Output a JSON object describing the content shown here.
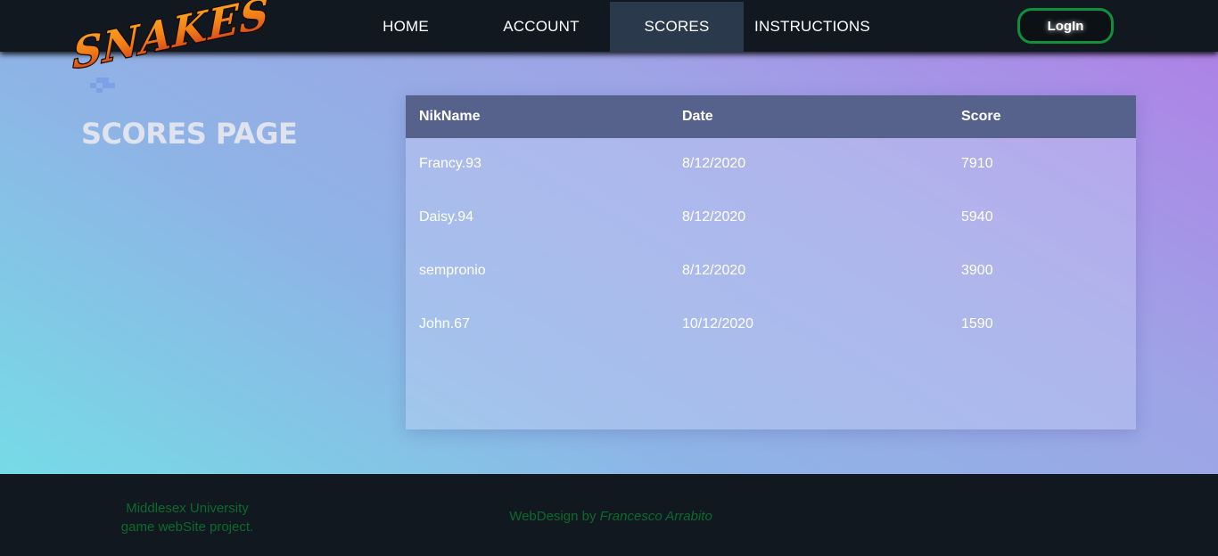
{
  "logo": {
    "text": "SNAKES"
  },
  "nav": {
    "items": [
      {
        "label": "HOME"
      },
      {
        "label": "ACCOUNT"
      },
      {
        "label": "SCORES"
      },
      {
        "label": "INSTRUCTIONS"
      }
    ],
    "active": "SCORES",
    "login_label": "LogIn"
  },
  "page": {
    "title": "SCORES PAGE"
  },
  "scores": {
    "headers": [
      "NikName",
      "Date",
      "Score"
    ],
    "rows": [
      {
        "name": "Francy.93",
        "date": "8/12/2020",
        "score": "7910"
      },
      {
        "name": "Daisy.94",
        "date": "8/12/2020",
        "score": "5940"
      },
      {
        "name": "sempronio",
        "date": "8/12/2020",
        "score": "3900"
      },
      {
        "name": "John.67",
        "date": "10/12/2020",
        "score": "1590"
      }
    ]
  },
  "footer": {
    "left_line1": "Middlesex University",
    "left_line2": "game webSite project.",
    "credit_prefix": "WebDesign by ",
    "credit_author": "Francesco Arrabito"
  },
  "colors": {
    "navbar_bg": "#111820",
    "active_tab": "#2b394c",
    "table_header": "#56618c",
    "login_border": "#11903c",
    "footer_text": "#0b6b2c",
    "logo_orange": "#f08a1c",
    "logo_red": "#d43d14"
  },
  "icons": [
    "snake-logo-icon",
    "snake-pixel-icon"
  ]
}
